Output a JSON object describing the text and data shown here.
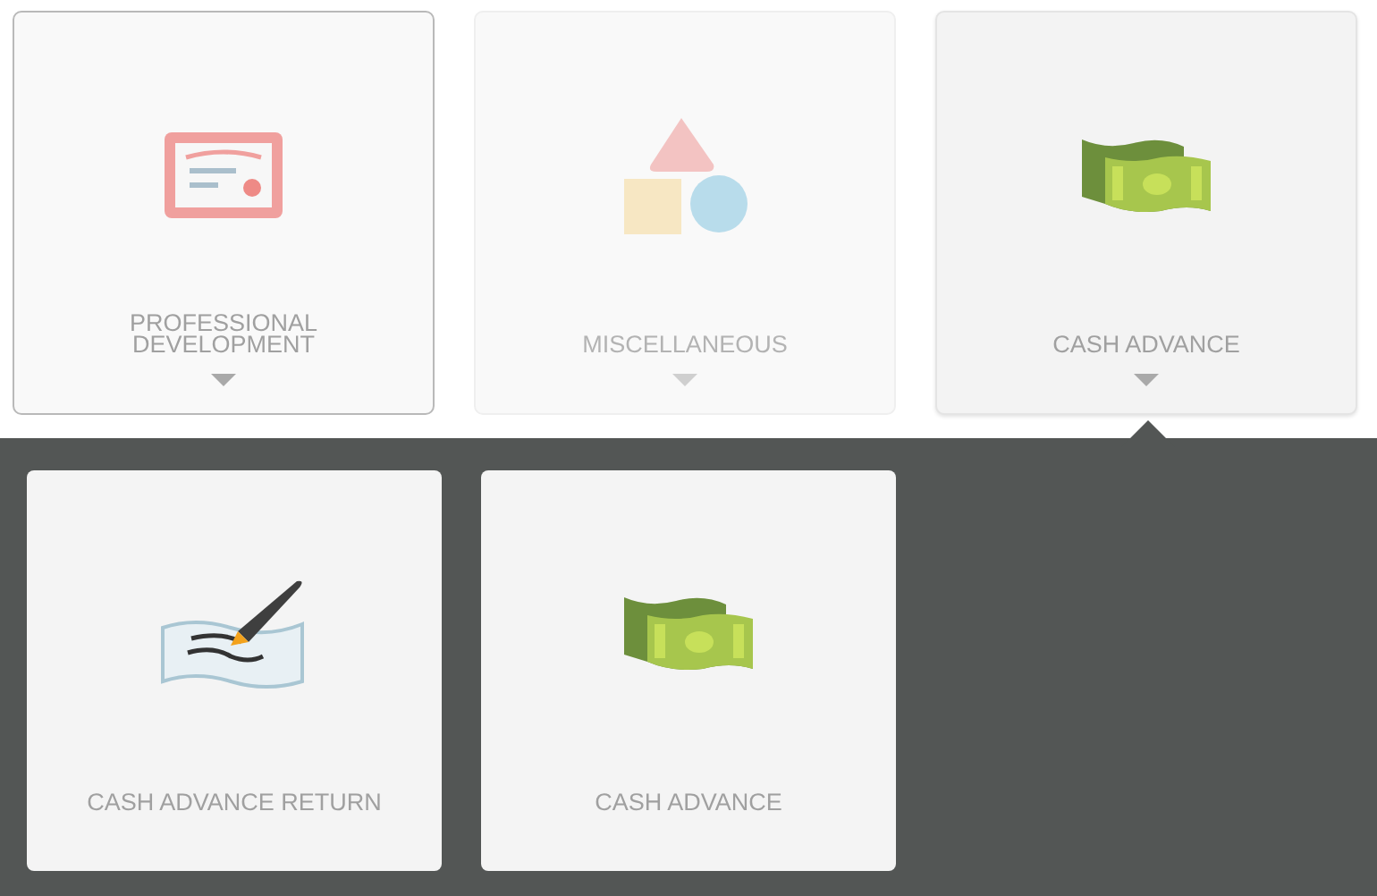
{
  "categories": [
    {
      "label": "PROFESSIONAL DEVELOPMENT",
      "kind": "certificate",
      "focused": true,
      "disabled": false,
      "selected": false
    },
    {
      "label": "MISCELLANEOUS",
      "kind": "shapes",
      "focused": false,
      "disabled": true,
      "selected": false
    },
    {
      "label": "CASH ADVANCE",
      "kind": "money",
      "focused": false,
      "disabled": false,
      "selected": true
    }
  ],
  "subcategories": [
    {
      "label": "CASH ADVANCE RETURN",
      "kind": "signature"
    },
    {
      "label": "CASH ADVANCE",
      "kind": "money"
    }
  ]
}
